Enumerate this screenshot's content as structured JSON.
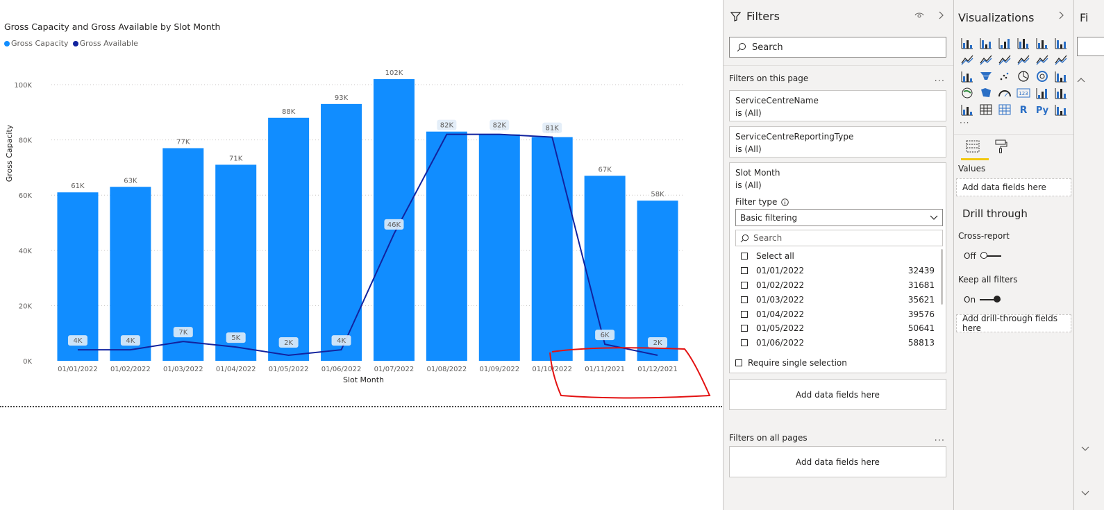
{
  "canvas": {
    "chart_title": "Gross Capacity and Gross Available by Slot Month",
    "legend": [
      {
        "label": "Gross Capacity",
        "color": "#118DFF"
      },
      {
        "label": "Gross Available",
        "color": "#12239E"
      }
    ]
  },
  "chart_data": {
    "type": "bar",
    "title": "Gross Capacity and Gross Available by Slot Month",
    "xlabel": "Slot Month",
    "ylabel": "Gross Capacity",
    "ylim": [
      0,
      100000
    ],
    "yticks": [
      "0K",
      "20K",
      "40K",
      "60K",
      "80K",
      "100K"
    ],
    "ytick_values": [
      0,
      20000,
      40000,
      60000,
      80000,
      100000
    ],
    "categories": [
      "01/01/2022",
      "01/02/2022",
      "01/03/2022",
      "01/04/2022",
      "01/05/2022",
      "01/06/2022",
      "01/07/2022",
      "01/08/2022",
      "01/09/2022",
      "01/10/2022",
      "01/11/2021",
      "01/12/2021"
    ],
    "series": [
      {
        "name": "Gross Capacity",
        "type": "bar",
        "color": "#118DFF",
        "values": [
          61000,
          63000,
          77000,
          71000,
          88000,
          93000,
          102000,
          83000,
          82000,
          81000,
          67000,
          58000
        ],
        "labels": [
          "61K",
          "63K",
          "77K",
          "71K",
          "88K",
          "93K",
          "102K",
          "83K",
          "82K",
          "81K",
          "67K",
          "58K"
        ]
      },
      {
        "name": "Gross Available",
        "type": "line",
        "color": "#12239E",
        "values": [
          4000,
          4000,
          7000,
          5000,
          2000,
          4000,
          46000,
          82000,
          82000,
          81000,
          6000,
          2000
        ],
        "labels": [
          "4K",
          "4K",
          "7K",
          "5K",
          "2K",
          "4K",
          "46K",
          "82K",
          "82K",
          "81K",
          "6K",
          "2K"
        ]
      }
    ],
    "grid": true,
    "legend": "top-left"
  },
  "filters": {
    "title": "Filters",
    "search_placeholder": "Search",
    "on_this_page": "Filters on this page",
    "more": "...",
    "cards": [
      {
        "name": "ServiceCentreName",
        "state": "is (All)"
      },
      {
        "name": "ServiceCentreReportingType",
        "state": "is (All)"
      }
    ],
    "slot_month": {
      "name": "Slot Month",
      "state": "is (All)",
      "filter_type_label": "Filter type",
      "filter_type_value": "Basic filtering",
      "search_placeholder": "Search",
      "select_all": "Select all",
      "items": [
        {
          "label": "01/01/2022",
          "count": "32439"
        },
        {
          "label": "01/02/2022",
          "count": "31681"
        },
        {
          "label": "01/03/2022",
          "count": "35621"
        },
        {
          "label": "01/04/2022",
          "count": "39576"
        },
        {
          "label": "01/05/2022",
          "count": "50641"
        },
        {
          "label": "01/06/2022",
          "count": "58813"
        }
      ],
      "require_single": "Require single selection"
    },
    "add_fields": "Add data fields here",
    "on_all_pages": "Filters on all pages"
  },
  "viz": {
    "title": "Visualizations",
    "values_label": "Values",
    "add_fields": "Add data fields here",
    "drill_title": "Drill through",
    "cross_report": "Cross-report",
    "cross_report_state": "Off",
    "keep_filters": "Keep all filters",
    "keep_filters_state": "On",
    "add_drill": "Add drill-through fields here",
    "icons": [
      "stacked-bar-icon",
      "stacked-column-icon",
      "clustered-bar-icon",
      "clustered-column-icon",
      "100-bar-icon",
      "100-column-icon",
      "line-chart-icon",
      "area-chart-icon",
      "stacked-area-icon",
      "line-column-icon",
      "line-clustered-icon",
      "ribbon-chart-icon",
      "waterfall-icon",
      "funnel-icon",
      "scatter-icon",
      "pie-chart-icon",
      "donut-chart-icon",
      "treemap-icon",
      "map-icon",
      "filled-map-icon",
      "gauge-icon",
      "card-icon",
      "multi-row-card-icon",
      "kpi-icon",
      "slicer-icon",
      "table-icon",
      "matrix-icon",
      "r-visual-icon",
      "python-visual-icon",
      "decomposition-tree-icon"
    ],
    "r_label": "R",
    "py_label": "Py",
    "card_label": "123"
  },
  "fields": {
    "title": "Fi"
  }
}
